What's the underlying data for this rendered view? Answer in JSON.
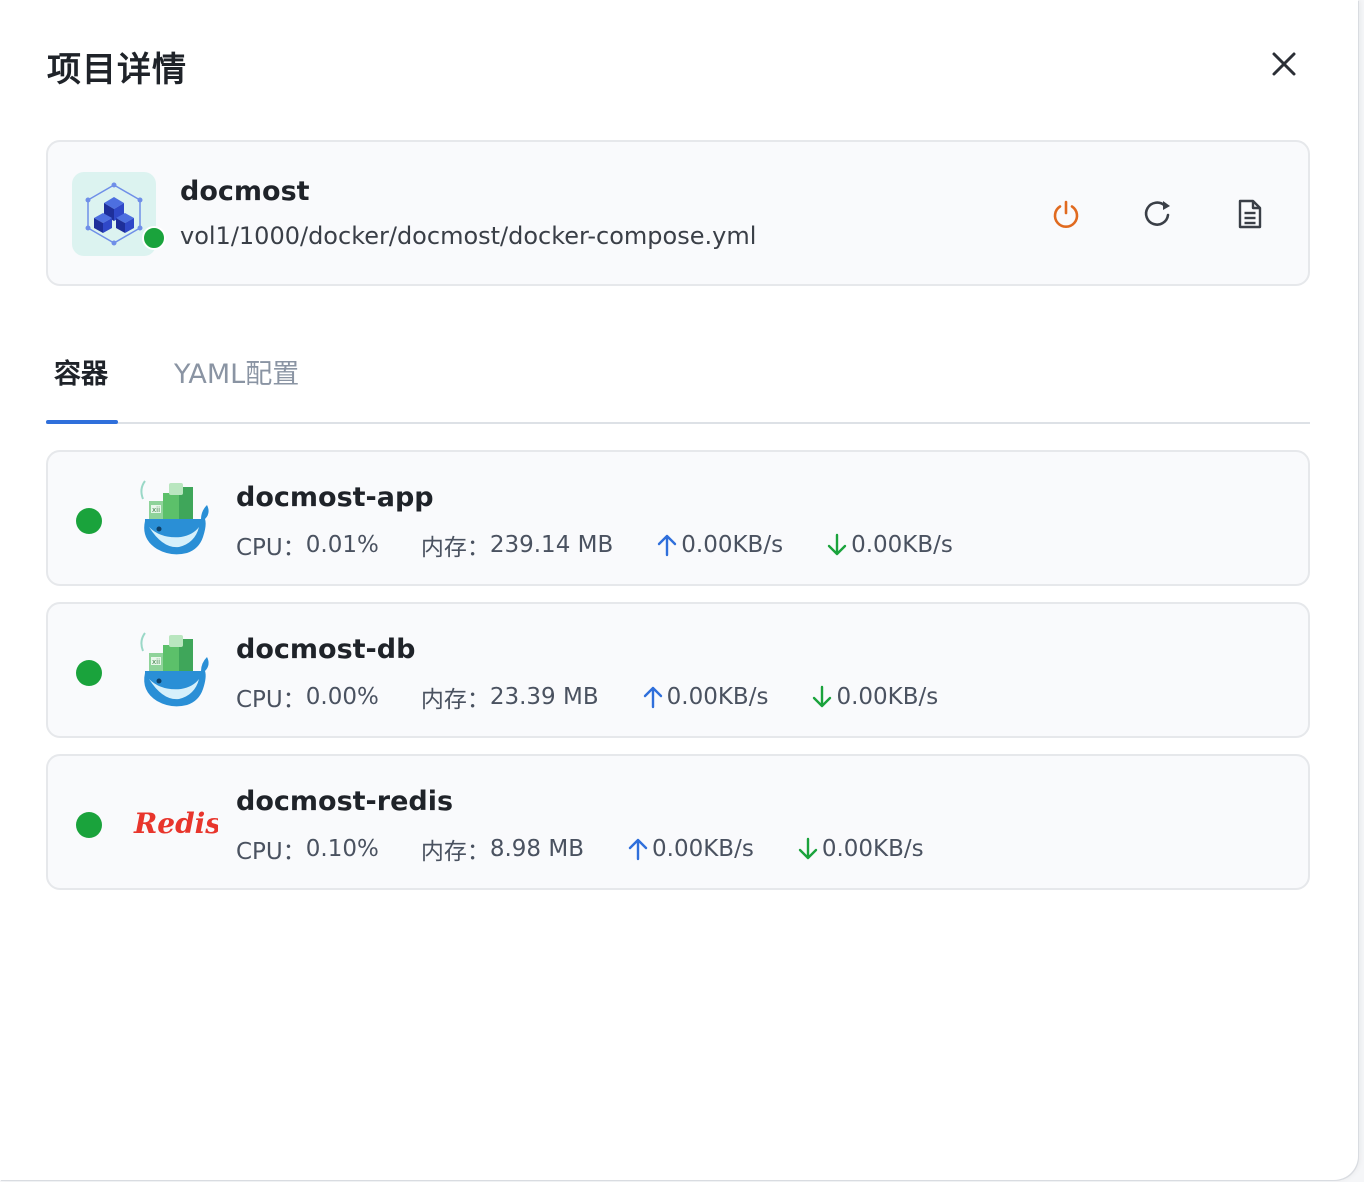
{
  "dialog": {
    "title": "项目详情"
  },
  "project": {
    "name": "docmost",
    "path": "vol1/1000/docker/docmost/docker-compose.yml",
    "status_color": "#1aa33c",
    "actions": [
      {
        "icon": "power-icon",
        "color": "#e06a1f"
      },
      {
        "icon": "restart-icon",
        "color": "#3a3f47"
      },
      {
        "icon": "document-icon",
        "color": "#3a3f47"
      }
    ]
  },
  "tabs": [
    {
      "label": "容器",
      "active": true
    },
    {
      "label": "YAML配置",
      "active": false
    }
  ],
  "containers": [
    {
      "name": "docmost-app",
      "icon": "docker-container-icon",
      "cpu_label": "CPU：",
      "cpu": "0.01%",
      "mem_label": "内存：",
      "mem": "239.14 MB",
      "up": "0.00KB/s",
      "down": "0.00KB/s"
    },
    {
      "name": "docmost-db",
      "icon": "docker-container-icon",
      "cpu_label": "CPU：",
      "cpu": "0.00%",
      "mem_label": "内存：",
      "mem": "23.39 MB",
      "up": "0.00KB/s",
      "down": "0.00KB/s"
    },
    {
      "name": "docmost-redis",
      "icon": "redis-logo-icon",
      "logo_text": "Redis",
      "cpu_label": "CPU：",
      "cpu": "0.10%",
      "mem_label": "内存：",
      "mem": "8.98 MB",
      "up": "0.00KB/s",
      "down": "0.00KB/s"
    }
  ],
  "colors": {
    "running": "#1aa33c",
    "upload_arrow": "#2f6fdb",
    "download_arrow": "#1aa33c",
    "tab_accent": "#2f6fdb"
  }
}
